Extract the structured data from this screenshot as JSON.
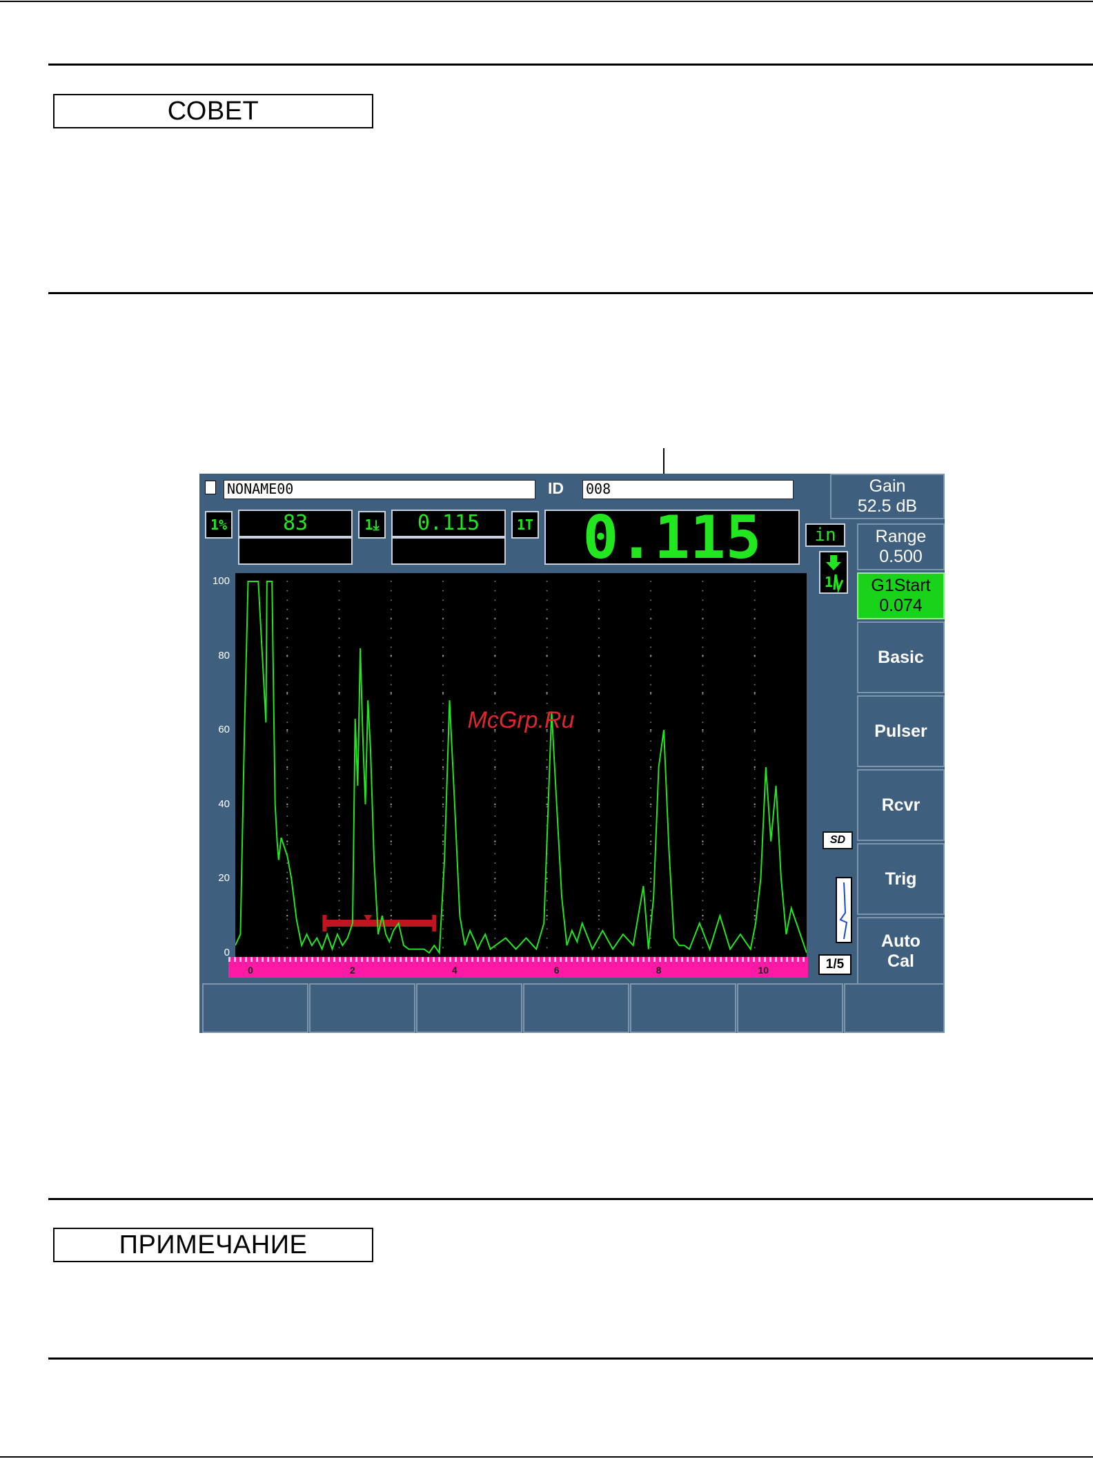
{
  "note_boxes": {
    "tip_label": "СОВЕТ",
    "note_label": "ПРИМЕЧАНИЕ"
  },
  "device": {
    "file_name": "NONAME00",
    "id_label": "ID",
    "id_value": "008",
    "readings": {
      "amp_tag": "1%",
      "amp_value": "83",
      "depth_tag": "1⤓",
      "depth_value": "0.115",
      "thick_tag": "1T",
      "main_value": "0.115",
      "unit": "in"
    },
    "right_panel": {
      "gain_label": "Gain",
      "gain_value": "52.5 dB",
      "range_label": "Range",
      "range_value": "0.500",
      "g1start_label": "G1Start",
      "g1start_value": "0.074",
      "basic": "Basic",
      "pulser": "Pulser",
      "rcvr": "Rcvr",
      "trig": "Trig",
      "autocal_line1": "Auto",
      "autocal_line2": "Cal"
    },
    "sd_badge": "SD",
    "page_indicator": "1/5",
    "watermark": "McGrp.Ru",
    "colors": {
      "screen_bg": "#3f5f7e",
      "trace": "#22e61f",
      "gate": "#c0141e",
      "ruler": "#ff1aa5",
      "highlight": "#19d21a"
    }
  },
  "chart_data": {
    "type": "line",
    "ylim": [
      0,
      100
    ],
    "xlim": [
      -0.3,
      10.9
    ],
    "y_ticks": [
      "100",
      "80",
      "60",
      "40",
      "20",
      "0"
    ],
    "x_ticks": [
      "0",
      "2",
      "4",
      "6",
      "8",
      "10"
    ],
    "grid": true,
    "series": [
      {
        "x": [
          -0.3,
          -0.2,
          -0.12,
          -0.05,
          0.0,
          0.05,
          0.15,
          0.3,
          0.32,
          0.36,
          0.42,
          0.45,
          0.48,
          0.52,
          0.55,
          0.6,
          0.72,
          0.8,
          0.9,
          1.0,
          1.1,
          1.2,
          1.3,
          1.4,
          1.5,
          1.6,
          1.7,
          1.8,
          1.9,
          2.0,
          2.05,
          2.1,
          2.15,
          2.2,
          2.25,
          2.3,
          2.35,
          2.42,
          2.5,
          2.58,
          2.65,
          2.72,
          2.8,
          2.9,
          3.0,
          3.1,
          3.2,
          3.3,
          3.4,
          3.5,
          3.6,
          3.7,
          3.8,
          3.9,
          4.0,
          4.1,
          4.2,
          4.3,
          4.4,
          4.45,
          4.52,
          4.6,
          4.7,
          4.8,
          5.0,
          5.2,
          5.4,
          5.6,
          5.75,
          5.9,
          6.0,
          6.1,
          6.2,
          6.3,
          6.4,
          6.5,
          6.7,
          6.9,
          7.1,
          7.3,
          7.5,
          7.7,
          7.8,
          7.9,
          8.0,
          8.1,
          8.2,
          8.3,
          8.4,
          8.5,
          8.6,
          8.8,
          9.0,
          9.2,
          9.4,
          9.6,
          9.8,
          9.9,
          10.0,
          10.1,
          10.2,
          10.3,
          10.4,
          10.5,
          10.6,
          10.9
        ],
        "y": [
          2,
          5,
          60,
          100,
          100,
          100,
          100,
          62,
          100,
          100,
          100,
          70,
          40,
          30,
          25,
          31,
          26,
          20,
          9,
          2,
          5,
          2,
          4,
          1,
          5,
          1,
          5,
          2,
          4,
          8,
          63,
          45,
          82,
          58,
          40,
          68,
          55,
          25,
          5,
          10,
          5,
          3,
          6,
          8,
          2,
          1,
          1,
          1,
          1,
          0,
          2,
          0,
          25,
          68,
          40,
          10,
          2,
          6,
          3,
          1,
          3,
          5,
          1,
          2,
          4,
          1,
          4,
          1,
          8,
          65,
          40,
          15,
          2,
          6,
          3,
          8,
          1,
          6,
          1,
          5,
          2,
          18,
          1,
          15,
          50,
          60,
          28,
          4,
          2,
          2,
          1,
          8,
          1,
          10,
          1,
          5,
          1,
          8,
          20,
          50,
          30,
          45,
          20,
          5,
          12,
          0
        ]
      }
    ]
  }
}
